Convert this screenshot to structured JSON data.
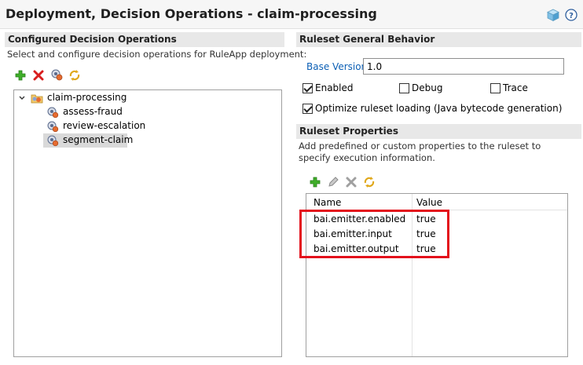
{
  "header": {
    "title": "Deployment, Decision Operations - claim-processing",
    "icons": [
      "cube-icon",
      "help-icon"
    ]
  },
  "left": {
    "section_title": "Configured Decision Operations",
    "description": "Select and configure decision operations for RuleApp deployment:",
    "toolbar": [
      "add-icon",
      "delete-icon",
      "configure-icon",
      "refresh-icon"
    ],
    "tree": {
      "root": "claim-processing",
      "children": [
        "assess-fraud",
        "review-escalation",
        "segment-claim"
      ],
      "selected": "segment-claim"
    }
  },
  "right": {
    "general_title": "Ruleset General Behavior",
    "base_version_label": "Base Version:",
    "base_version_value": "1.0",
    "enabled_label": "Enabled",
    "enabled_checked": true,
    "debug_label": "Debug",
    "debug_checked": false,
    "trace_label": "Trace",
    "trace_checked": false,
    "optimize_label": "Optimize ruleset loading (Java bytecode generation)",
    "optimize_checked": true,
    "properties_title": "Ruleset Properties",
    "properties_description": "Add predefined or custom properties to the ruleset to specify execution information.",
    "toolbar": [
      "add-icon",
      "edit-icon",
      "delete-icon",
      "refresh-icon"
    ],
    "table": {
      "headers": [
        "Name",
        "Value"
      ],
      "rows": [
        {
          "name": "bai.emitter.enabled",
          "value": "true"
        },
        {
          "name": "bai.emitter.input",
          "value": "true"
        },
        {
          "name": "bai.emitter.output",
          "value": "true"
        }
      ]
    },
    "highlight_color": "#e3111c"
  }
}
